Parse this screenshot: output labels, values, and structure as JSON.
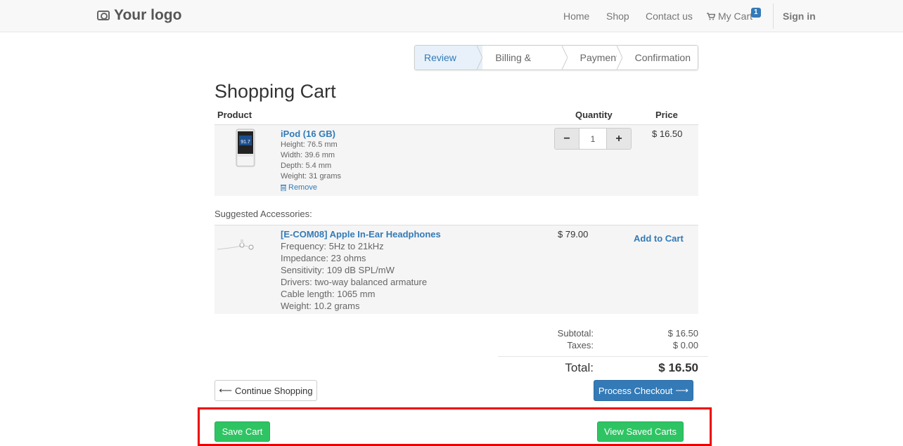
{
  "navbar": {
    "logo": "Your logo",
    "links": [
      "Home",
      "Shop",
      "Contact us"
    ],
    "cart_label": "My Cart",
    "cart_count": "1",
    "signin": "Sign in"
  },
  "steps": [
    "Review Order",
    "Billing & Shipping",
    "Payment",
    "Confirmation"
  ],
  "page_title": "Shopping Cart",
  "table_headers": {
    "product": "Product",
    "quantity": "Quantity",
    "price": "Price"
  },
  "cart_item": {
    "name": "iPod (16 GB)",
    "specs": [
      "Height: 76.5 mm",
      "Width: 39.6 mm",
      "Depth: 5.4 mm",
      "Weight: 31 grams"
    ],
    "remove": "Remove",
    "quantity": "1",
    "price": "$ 16.50"
  },
  "suggest_label": "Suggested Accessories:",
  "accessory": {
    "name": "[E-COM08] Apple In-Ear Headphones",
    "specs": [
      "Frequency: 5Hz to 21kHz",
      "Impedance: 23 ohms",
      "Sensitivity: 109 dB SPL/mW",
      "Drivers: two-way balanced armature",
      "Cable length: 1065 mm",
      "Weight: 10.2 grams"
    ],
    "price": "$ 79.00",
    "add_label": "Add to Cart"
  },
  "summary": {
    "subtotal_label": "Subtotal:",
    "subtotal": "$ 16.50",
    "taxes_label": "Taxes:",
    "taxes": "$ 0.00",
    "total_label": "Total:",
    "total": "$ 16.50"
  },
  "buttons": {
    "continue": "Continue Shopping",
    "checkout": "Process Checkout",
    "save": "Save Cart",
    "view_saved": "View Saved Carts"
  },
  "colors": {
    "primary": "#337ab7",
    "success": "#2fc463",
    "highlight": "#ee0000"
  }
}
